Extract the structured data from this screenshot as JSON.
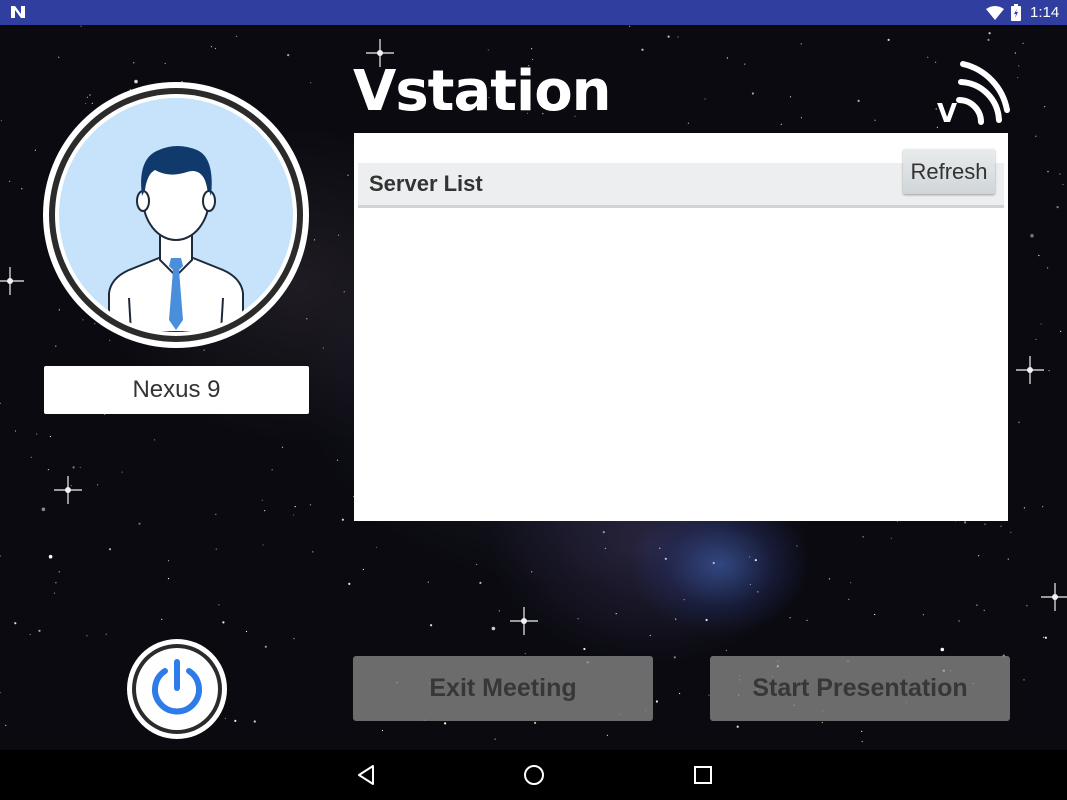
{
  "status_bar": {
    "time": "1:14"
  },
  "app": {
    "title": "Vstation",
    "logo_letter": "V"
  },
  "device": {
    "name": "Nexus 9"
  },
  "server_list": {
    "title": "Server List",
    "refresh_label": "Refresh",
    "items": []
  },
  "buttons": {
    "exit_meeting": "Exit Meeting",
    "start_presentation": "Start Presentation"
  },
  "icons": {
    "status": [
      "notification-n-icon",
      "wifi-icon",
      "battery-icon"
    ],
    "nav": [
      "back-icon",
      "home-icon",
      "recents-icon"
    ],
    "power": "power-icon",
    "avatar": "user-avatar-icon",
    "logo": "cast-signal-logo-icon"
  },
  "colors": {
    "status_bar": "#303f9f",
    "power_accent": "#2d7ce8",
    "tie": "#4a8fdb",
    "avatar_bg": "#c7e3fb"
  }
}
